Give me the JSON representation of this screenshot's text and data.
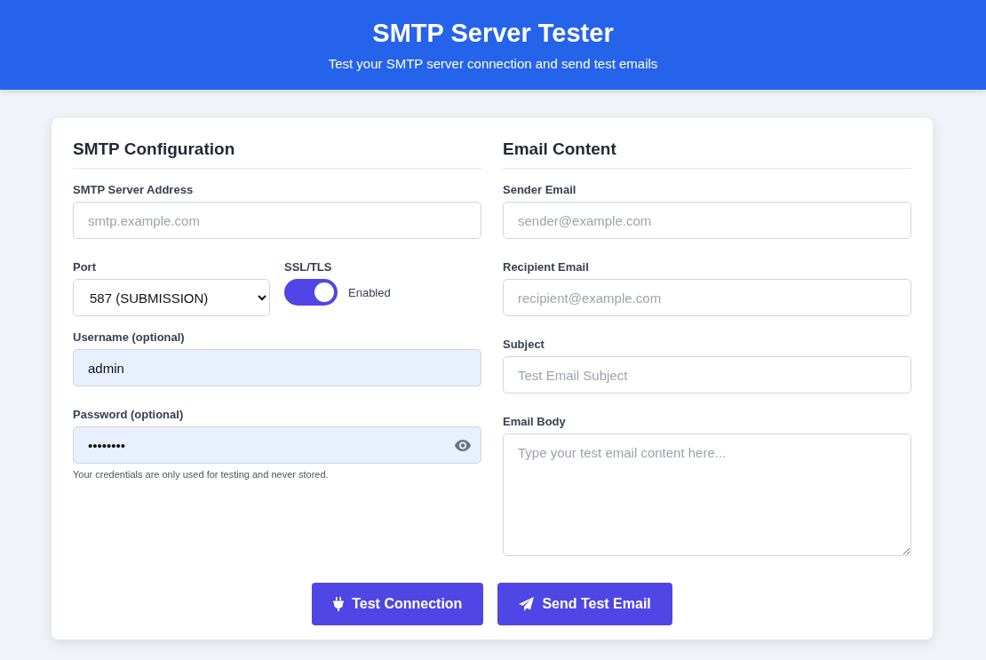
{
  "header": {
    "title": "SMTP Server Tester",
    "subtitle": "Test your SMTP server connection and send test emails"
  },
  "smtp": {
    "heading": "SMTP Configuration",
    "server": {
      "label": "SMTP Server Address",
      "placeholder": "smtp.example.com"
    },
    "port": {
      "label": "Port",
      "value": "587 (SUBMISSION)"
    },
    "ssl": {
      "label": "SSL/TLS",
      "on": true,
      "state_label": "Enabled"
    },
    "username": {
      "label": "Username (optional)",
      "value": "admin"
    },
    "password": {
      "label": "Password (optional)",
      "value": "••••••••"
    },
    "note": "Your credentials are only used for testing and never stored."
  },
  "email": {
    "heading": "Email Content",
    "fields": [
      {
        "label": "Sender Email",
        "placeholder": "sender@example.com"
      },
      {
        "label": "Recipient Email",
        "placeholder": "recipient@example.com"
      },
      {
        "label": "Subject",
        "placeholder": "Test Email Subject"
      }
    ],
    "body": {
      "label": "Email Body",
      "placeholder": "Type your test email content here..."
    }
  },
  "buttons": [
    {
      "kind": "test",
      "label": "Test Connection"
    },
    {
      "kind": "send",
      "label": "Send Test Email"
    }
  ]
}
